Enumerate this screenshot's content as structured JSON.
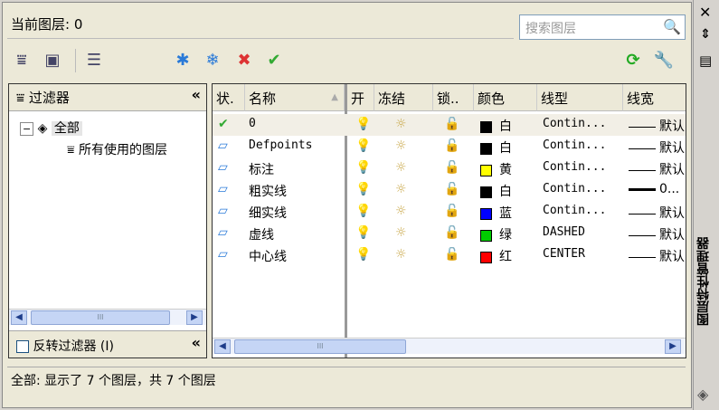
{
  "header": {
    "current_layer_label": "当前图层:",
    "current_layer_value": "0",
    "search_placeholder": "搜索图层"
  },
  "filter_panel": {
    "title": "过滤器",
    "tree": [
      {
        "label": "全部",
        "expanded": true
      },
      {
        "label": "所有使用的图层"
      }
    ],
    "invert_label": "反转过滤器 (I)",
    "invert_checked": false
  },
  "columns": [
    "状.",
    "名称",
    "开",
    "冻结",
    "锁..",
    "颜色",
    "线型",
    "线宽"
  ],
  "layers": [
    {
      "name": "0",
      "current": true,
      "color_name": "白",
      "color": "#000000",
      "linetype": "Contin...",
      "lineweight": "默认",
      "lw_bold": false
    },
    {
      "name": "Defpoints",
      "color_name": "白",
      "color": "#000000",
      "linetype": "Contin...",
      "lineweight": "默认"
    },
    {
      "name": "标注",
      "color_name": "黄",
      "color": "#ffff00",
      "linetype": "Contin...",
      "lineweight": "默认"
    },
    {
      "name": "粗实线",
      "color_name": "白",
      "color": "#000000",
      "linetype": "Contin...",
      "lineweight": "0...",
      "lw_bold": true
    },
    {
      "name": "细实线",
      "color_name": "蓝",
      "color": "#0000ff",
      "linetype": "Contin...",
      "lineweight": "默认"
    },
    {
      "name": "虚线",
      "color_name": "绿",
      "color": "#00cc00",
      "linetype": "DASHED",
      "lineweight": "默认"
    },
    {
      "name": "中心线",
      "color_name": "红",
      "color": "#ff0000",
      "linetype": "CENTER",
      "lineweight": "默认"
    }
  ],
  "status": "全部: 显示了 7 个图层，共 7 个图层",
  "side_title": "图层特性管理器"
}
